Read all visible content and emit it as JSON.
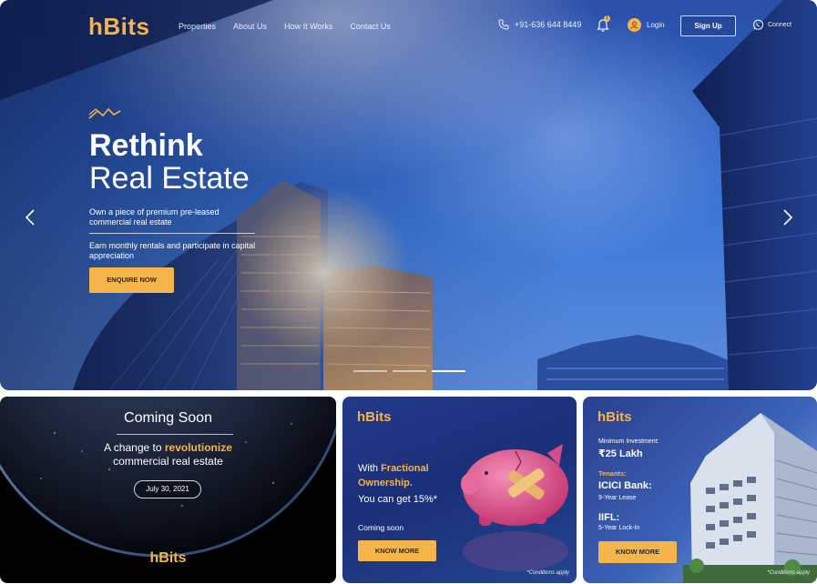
{
  "nav": {
    "logo": "hBits",
    "menu": [
      "Properties",
      "About Us",
      "How It Works",
      "Contact Us"
    ],
    "phone": "+91-636 644 8449",
    "notification_count": "1",
    "login": "Login",
    "signup": "Sign Up",
    "connect": "Connect"
  },
  "hero": {
    "title_line1": "Rethink",
    "title_line2": "Real Estate",
    "subtitle1": "Own a piece of premium pre-leased commercial real estate",
    "subtitle2": "Earn monthly rentals and participate in capital appreciation",
    "cta": "ENQUIRE NOW",
    "slides": 3,
    "active_slide": 2
  },
  "card_coming_soon": {
    "title": "Coming Soon",
    "line1_prefix": "A change to ",
    "line1_highlight": "revolutionize",
    "line2": "commercial real estate",
    "date": "July 30, 2021",
    "logo": "hBits"
  },
  "card_fractional": {
    "logo": "hBits",
    "line1_prefix": "With ",
    "line1_highlight": "Fractional",
    "line2": "Ownership.",
    "line3": "You can get  15%*",
    "coming_soon": "Coming soon",
    "cta": "KNOW MORE",
    "note": "*Conditions apply"
  },
  "card_investment": {
    "logo": "hBits",
    "min_label": "Minimum Investment:",
    "min_value": "₹25 Lakh",
    "tenants_label": "Tenants:",
    "tenant1": "ICICI Bank:",
    "tenant1_lease": "9-Year Lease",
    "tenant2": "IIFL:",
    "tenant2_lease": "5-Year Lock-In",
    "cta": "KNOW MORE",
    "note": "*Conditions apply"
  },
  "colors": {
    "accent": "#f5b54a",
    "hero_sky": "#2f66c9",
    "card_navy": "#1a2f78"
  }
}
